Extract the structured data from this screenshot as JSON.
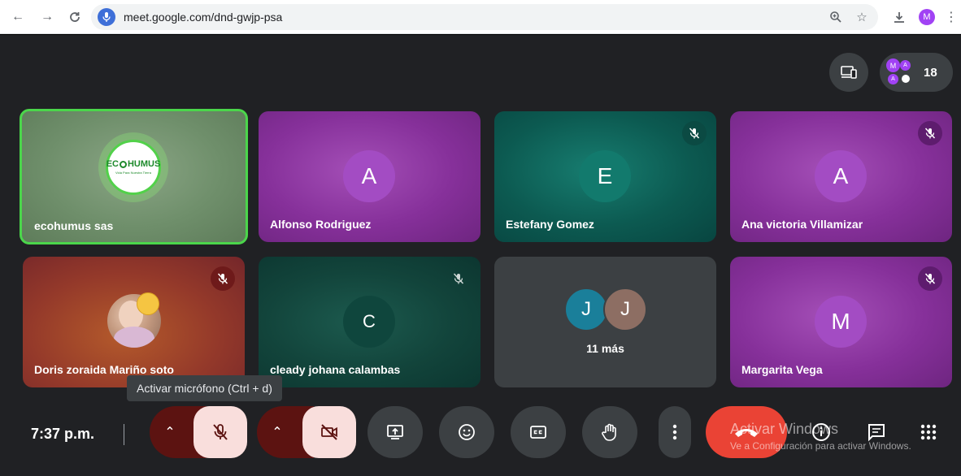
{
  "browser": {
    "url": "meet.google.com/dnd-gwjp-psa",
    "profile_initial": "M"
  },
  "meeting": {
    "participant_count": "18",
    "time": "7:37 p.m.",
    "tooltip": "Activar micrófono (Ctrl + d)",
    "more_label": "11 más",
    "more_avatars": [
      "J",
      "J"
    ],
    "count_avatars": [
      "M",
      "A",
      "A"
    ]
  },
  "tiles": [
    {
      "name": "ecohumus sas",
      "logo_text": "EC",
      "logo_text2": "HUMUS",
      "logo_tagline": "Vida Para Nuestra Tierra"
    },
    {
      "name": "Alfonso Rodriguez",
      "initial": "A"
    },
    {
      "name": "Estefany Gomez",
      "initial": "E"
    },
    {
      "name": "Ana victoria Villamizar",
      "initial": "A"
    },
    {
      "name": "Doris zoraida Mariño soto"
    },
    {
      "name": "cleady johana calambas",
      "initial": "C"
    },
    {
      "name": "Margarita Vega",
      "initial": "M"
    }
  ],
  "watermark": {
    "line1": "Activar Windows",
    "line2": "Ve a Configuración para activar Windows."
  },
  "colors": {
    "speaking_border": "#4bd64b",
    "hangup": "#ea4335",
    "muted_button": "#f9dedc"
  }
}
